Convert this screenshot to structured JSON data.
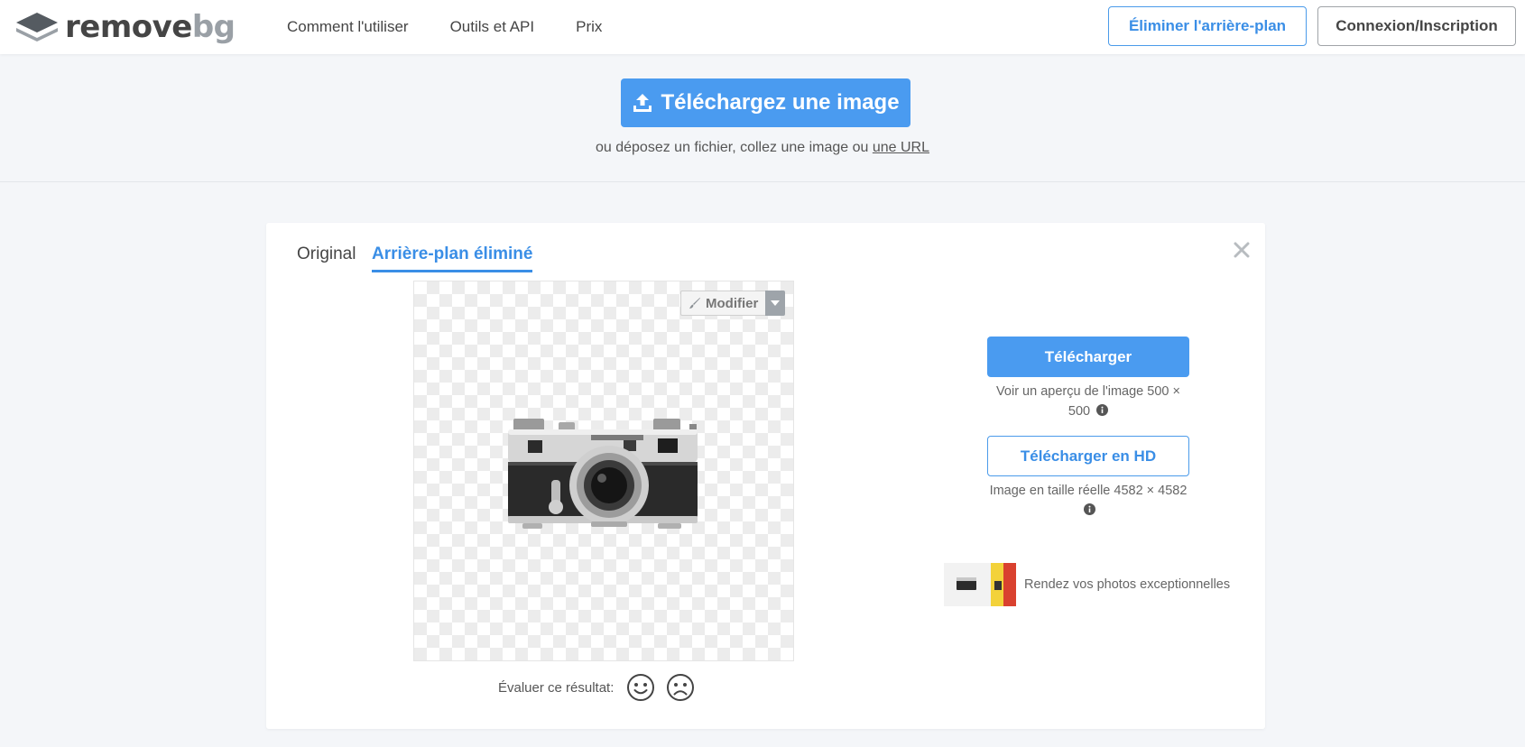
{
  "header": {
    "logo": {
      "word1": "remove",
      "word2": "bg",
      "icon": "stack-layers-icon"
    },
    "nav": [
      "Comment l'utiliser",
      "Outils et API",
      "Prix"
    ],
    "remove_bg_button": "Éliminer l'arrière-plan",
    "login_button": "Connexion/Inscription"
  },
  "upload": {
    "button_label": "Téléchargez une image",
    "button_icon": "upload-icon",
    "hint_prefix": "ou déposez un fichier, collez une image ou",
    "hint_link": "une URL"
  },
  "result": {
    "tabs": {
      "original": "Original",
      "removed": "Arrière-plan éliminé",
      "active": "removed"
    },
    "edit_label": "Modifier",
    "rate_label": "Évaluer ce résultat:",
    "download": {
      "label": "Télécharger",
      "note_line1": "Voir un aperçu de l'image 500 ×",
      "note_line2": "500"
    },
    "download_hd": {
      "label": "Télécharger en HD",
      "note": "Image en taille réelle 4582 × 4582"
    },
    "promo_text": "Rendez vos photos exceptionnelles"
  },
  "colors": {
    "accent": "#4a9bf0",
    "accent_text": "#3a8ee6",
    "page_bg": "#f4f6f9",
    "card_bg": "#ffffff"
  }
}
